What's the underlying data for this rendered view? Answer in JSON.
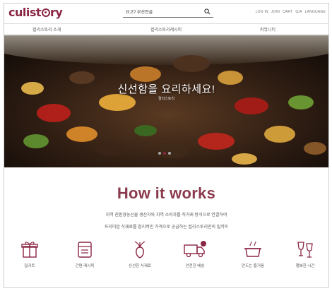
{
  "brand": {
    "logo_text_pre": "culist",
    "logo_text_post": "ry",
    "accent": "#8a2542"
  },
  "search": {
    "value": "요고? 부산전골"
  },
  "util_links": [
    "LOG IN",
    "JOIN",
    "CART",
    "Q/A",
    "LANGUAGE"
  ],
  "nav": {
    "items": [
      "컬리스토리 소개",
      "컬리스토리레시피",
      "커뮤니티"
    ]
  },
  "hero": {
    "title": "신선함을 요리하세요!",
    "subtitle": "컬리스토리",
    "slides": 3,
    "active_slide": 1
  },
  "how": {
    "title": "How it works",
    "desc_line1": "지역 친환경농산물 생산자와 지역 소비자를 직거래 방식으로 연결하여",
    "desc_line2": "프리미엄 식재료를 합리적인 가격으로 공급하는 컬리스토리만의 밀키트"
  },
  "features": [
    {
      "label": "밀키트",
      "icon": "gift-box-icon"
    },
    {
      "label": "간편 레시피",
      "icon": "recipe-book-icon"
    },
    {
      "label": "신선한 식재료",
      "icon": "vegetable-icon"
    },
    {
      "label": "안전한 배송",
      "icon": "delivery-truck-icon"
    },
    {
      "label": "만드는 즐거움",
      "icon": "cooking-pot-icon"
    },
    {
      "label": "행복한 시간",
      "icon": "wine-glasses-icon"
    }
  ]
}
